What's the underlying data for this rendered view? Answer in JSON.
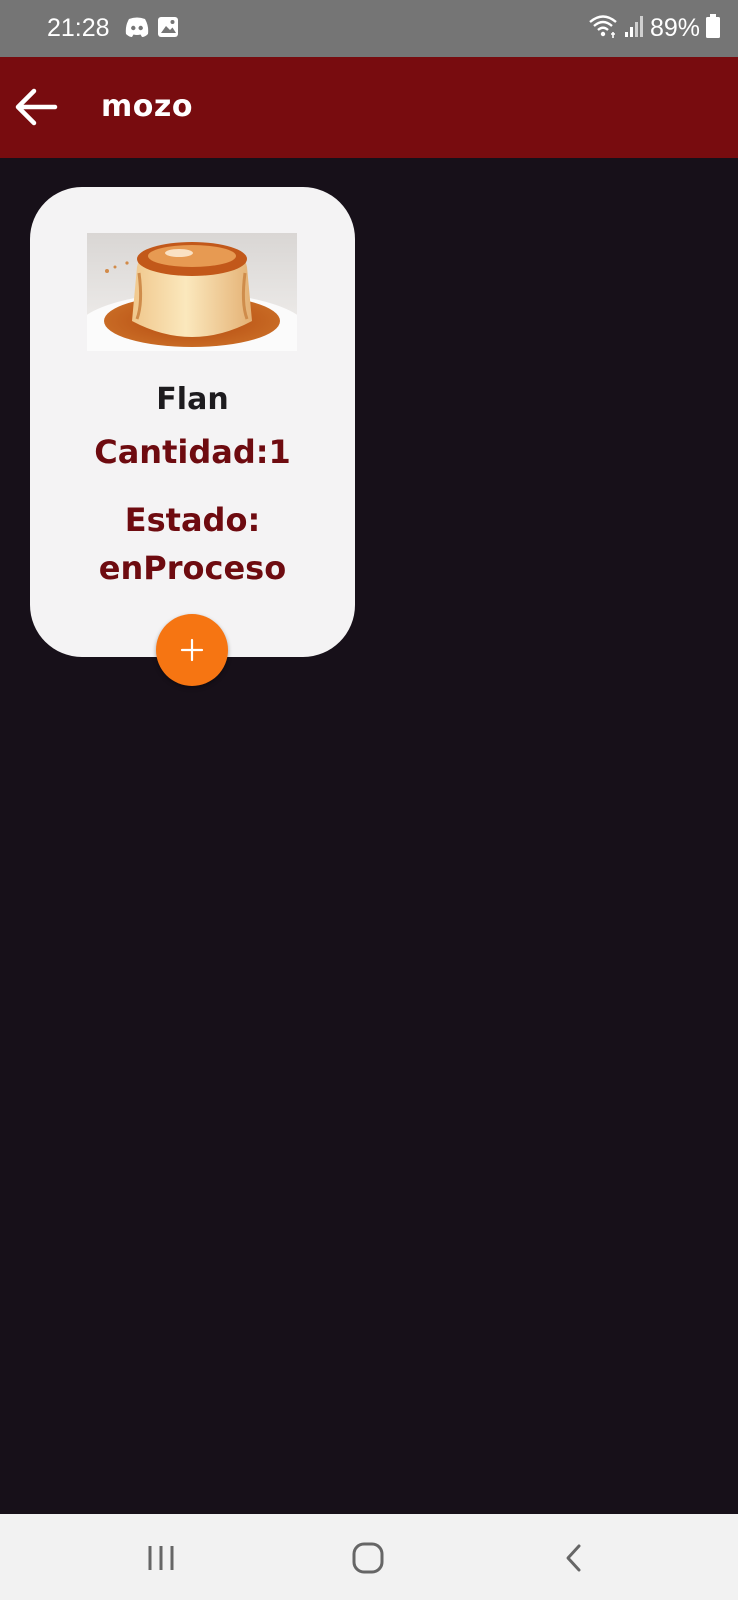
{
  "status_bar": {
    "time": "21:28",
    "battery": "89%",
    "icons": [
      "discord-icon",
      "image-icon",
      "wifi-icon",
      "signal-icon",
      "battery-icon"
    ]
  },
  "app_bar": {
    "title": "mozo",
    "back_icon": "arrow-back-icon"
  },
  "order_card": {
    "dish_name": "Flan",
    "quantity": "Cantidad:1",
    "state_label": "Estado:",
    "state_value": "enProceso",
    "add_icon": "plus-icon"
  },
  "nav_bar": {
    "icons": [
      "recent-apps-icon",
      "home-icon",
      "back-icon"
    ]
  },
  "colors": {
    "status_bar": "#757575",
    "app_bar": "#780c0f",
    "background": "#171019",
    "card": "#f4f3f4",
    "accent_text": "#6e0b10",
    "fab": "#f67512",
    "nav_bar": "#f2f2f2"
  }
}
